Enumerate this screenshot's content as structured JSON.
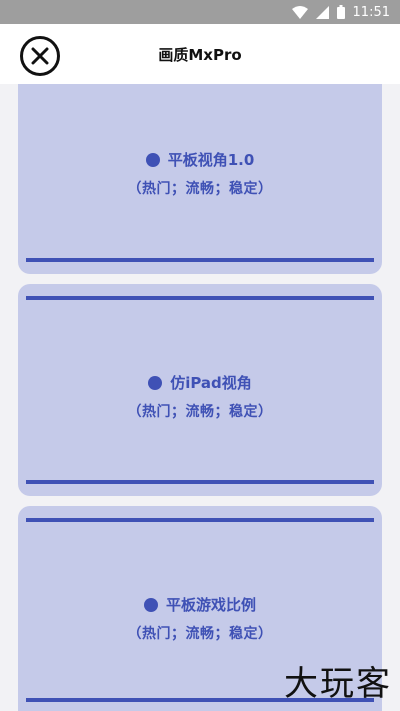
{
  "status_bar": {
    "time": "11:51",
    "icons": [
      "wifi-icon",
      "signal-icon",
      "battery-icon"
    ]
  },
  "header": {
    "title": "画质MxPro",
    "close_icon": "close-icon"
  },
  "cards": [
    {
      "title": "平板视角1.0",
      "subtitle": "（热门；流畅；稳定）"
    },
    {
      "title": "仿iPad视角",
      "subtitle": "（热门；流畅；稳定）"
    },
    {
      "title": "平板游戏比例",
      "subtitle": "（热门；流畅；稳定）"
    }
  ],
  "watermark": "大玩客",
  "colors": {
    "accent": "#3f51b5",
    "card_bg": "#c5cae9",
    "status_bar": "#9e9e9e"
  }
}
